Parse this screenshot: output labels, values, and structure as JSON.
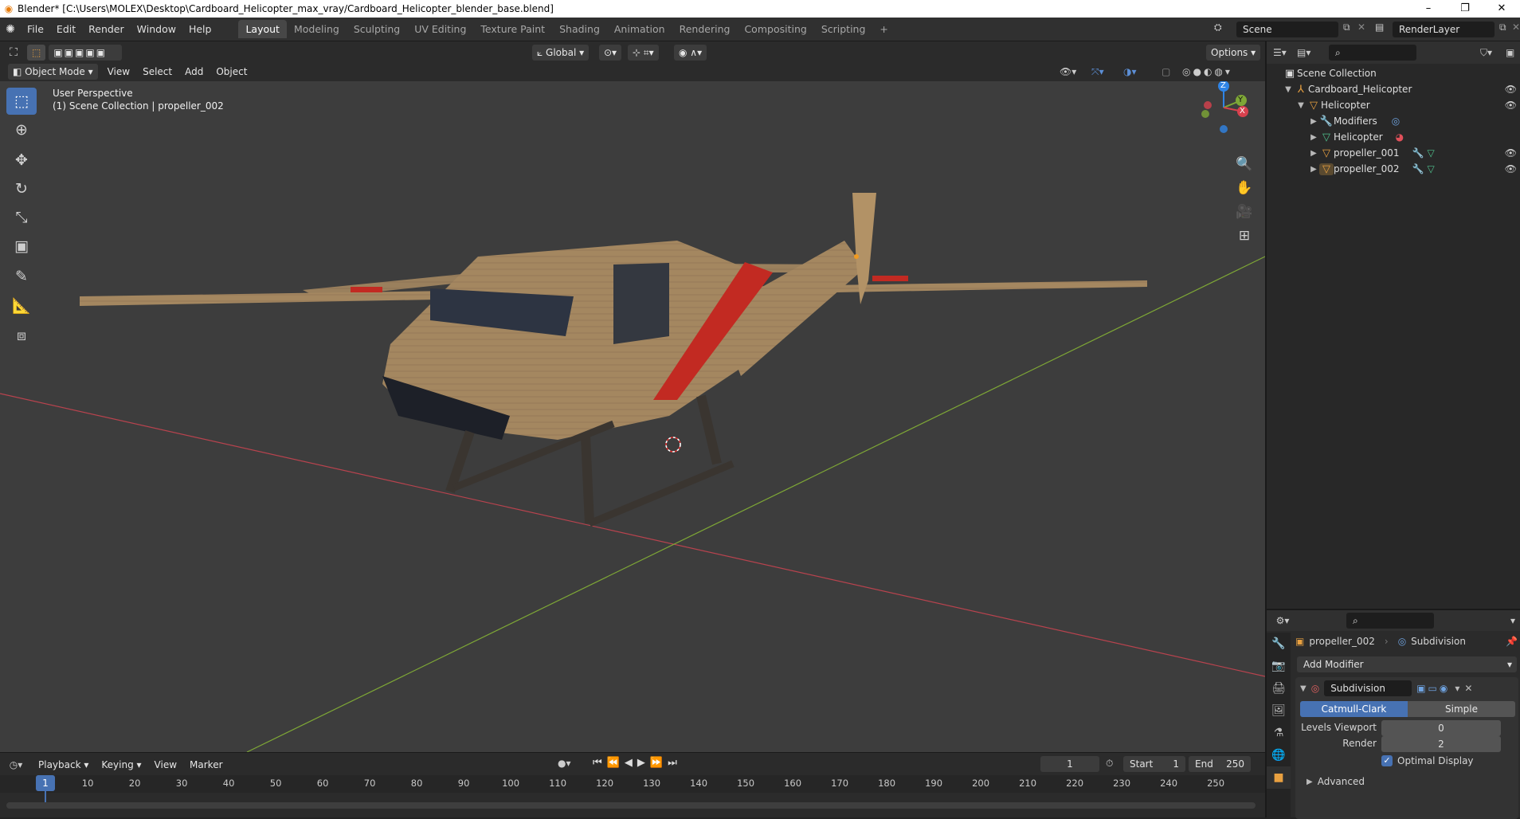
{
  "window": {
    "title": "Blender* [C:\\Users\\MOLEX\\Desktop\\Cardboard_Helicopter_max_vray/Cardboard_Helicopter_blender_base.blend]",
    "minimize": "–",
    "maximize": "❐",
    "close": "✕"
  },
  "menu": [
    "File",
    "Edit",
    "Render",
    "Window",
    "Help"
  ],
  "workspaces": [
    "Layout",
    "Modeling",
    "Sculpting",
    "UV Editing",
    "Texture Paint",
    "Shading",
    "Animation",
    "Rendering",
    "Compositing",
    "Scripting"
  ],
  "workspace_add": "+",
  "scene": {
    "name": "Scene",
    "render_layer": "RenderLayer"
  },
  "viewport_header": {
    "transform_orientation": "Global",
    "options_label": "Options",
    "mode": "Object Mode",
    "menus": [
      "View",
      "Select",
      "Add",
      "Object"
    ]
  },
  "viewport": {
    "perspective_label": "User Perspective",
    "collection_label": "(1) Scene Collection | propeller_002",
    "gizmo": {
      "z": "Z",
      "y": "Y",
      "x": "X"
    }
  },
  "outliner": {
    "root": "Scene Collection",
    "items": [
      {
        "label": "Cardboard_Helicopter"
      },
      {
        "label": "Helicopter"
      },
      {
        "label": "Modifiers"
      },
      {
        "label": "Helicopter"
      },
      {
        "label": "propeller_001"
      },
      {
        "label": "propeller_002"
      }
    ]
  },
  "properties": {
    "object_name": "propeller_002",
    "modifier_breadcrumb": "Subdivision",
    "add_modifier": "Add Modifier",
    "modifier_name": "Subdivision",
    "method_options": [
      "Catmull-Clark",
      "Simple"
    ],
    "method_selected": "Catmull-Clark",
    "levels_viewport_label": "Levels Viewport",
    "levels_viewport": "0",
    "render_label": "Render",
    "render_levels": "2",
    "optimal_display_label": "Optimal Display",
    "optimal_display": true,
    "advanced_label": "Advanced"
  },
  "timeline": {
    "menus": [
      "Playback",
      "Keying",
      "View",
      "Marker"
    ],
    "current_frame": "1",
    "start_label": "Start",
    "start": "1",
    "end_label": "End",
    "end": "250",
    "ruler": [
      "1",
      "10",
      "20",
      "30",
      "40",
      "50",
      "60",
      "70",
      "80",
      "90",
      "100",
      "110",
      "120",
      "130",
      "140",
      "150",
      "160",
      "170",
      "180",
      "190",
      "200",
      "210",
      "220",
      "230",
      "240",
      "250"
    ]
  },
  "colors": {
    "accent": "#4772b3",
    "cardboard": "#a48760",
    "red_stripe": "#c22a22",
    "x_axis": "#b8434e",
    "y_axis": "#7ea736",
    "gizmo_z": "#2f84e6"
  }
}
